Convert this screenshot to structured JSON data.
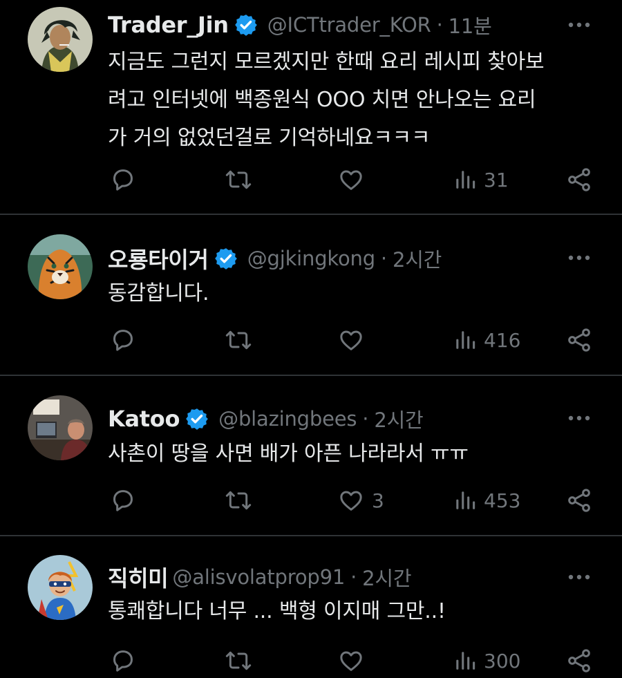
{
  "colors": {
    "background": "#000000",
    "text_primary": "#e7e9ea",
    "text_secondary": "#71767b",
    "divider": "#2f3336",
    "verified_badge": "#1d9bf0"
  },
  "icons": {
    "reply": "reply-icon",
    "retweet": "retweet-icon",
    "like": "heart-icon",
    "views": "views-icon",
    "share": "share-icon",
    "more": "more-icon",
    "verified": "verified-badge-icon"
  },
  "tweets": [
    {
      "name": "Trader_Jin",
      "verified": true,
      "handle": "@ICTtrader_KOR",
      "separator": "·",
      "time": "11분",
      "text_lines": [
        "지금도 그런지 모르겠지만 한때 요리 레시피 찾아보",
        "려고 인터넷에 백종원식 OOO 치면  안나오는 요리",
        "가 거의 없었던걸로 기억하네요ㅋㅋㅋ"
      ],
      "likes": "",
      "views": "31"
    },
    {
      "name": "오룡타이거",
      "verified": true,
      "handle": "@gjkingkong",
      "separator": "·",
      "time": "2시간",
      "text_lines": [
        "동감합니다."
      ],
      "likes": "",
      "views": "416"
    },
    {
      "name": "Katoo",
      "verified": true,
      "handle": "@blazingbees",
      "separator": "·",
      "time": "2시간",
      "text_lines": [
        "사촌이 땅을 사면 배가 아픈 나라라서 ㅠㅠ"
      ],
      "likes": "3",
      "views": "453"
    },
    {
      "name": "직히미",
      "verified": false,
      "handle": "@alisvolatprop91",
      "separator": "·",
      "time": "2시간",
      "text_lines": [
        "통쾌합니다 너무 ... 백형 이지매 그만..!"
      ],
      "likes": "",
      "views": "300"
    }
  ]
}
